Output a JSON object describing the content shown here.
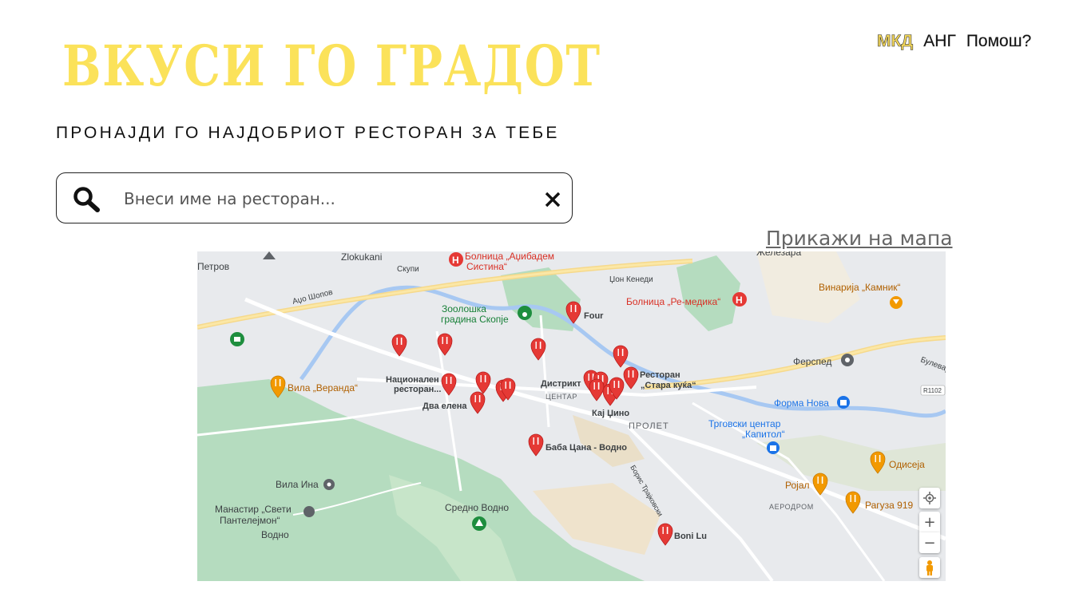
{
  "lang": {
    "mk": "МКД",
    "en": "АНГ",
    "help": "Помош?"
  },
  "header": {
    "title": "ВКУСИ ГО ГРАДОТ",
    "subtitle": "ПРОНАЈДИ ГО НАЈДОБРИОТ РЕСТОРАН ЗА ТЕБЕ"
  },
  "search": {
    "placeholder": "Внеси име на ресторан...",
    "value": ""
  },
  "map_link": "Прикажи на мапа",
  "colors": {
    "accent": "#fbe25a",
    "pin_red": "#e53935",
    "pin_orange": "#f29900",
    "park_green": "#9fd3ad",
    "water": "#a7c8f2"
  },
  "map": {
    "labels": {
      "zlokukani": "Zlokukani",
      "petrov": "Петров",
      "skupi": "Скупи",
      "acoShopov": "Аџо Шопов",
      "hospital_acibadem": "Болница „Аџибадем Систина“",
      "zoo": "Зоолошка градина Скопје",
      "four": "Four",
      "jonKenedi": "Џон Кенеди",
      "hospital_remedika": "Болница „Ре-медика“",
      "vinarija": "Винарија „Камник“",
      "zelezara": "Железара",
      "ferspet": "Ферспед",
      "bulevar": "Булевар",
      "r1102": "R1102",
      "vila_veranda": "Вила „Веранда“",
      "nacionalen1": "Национален",
      "nacionalen2": "ресторан...",
      "dva_elena": "Два елена",
      "distrikt": "Дистрикт",
      "centar": "ЦЕНТАР",
      "kaj_cino": "Кај Џино",
      "restoran1": "Ресторан",
      "restoran2": "„Стара куќа“",
      "prolet": "ПРОЛЕТ",
      "forma_nova": "Форма Нова",
      "trgovski1": "Трговски центар",
      "trgovski2": "„Капитол“",
      "baba_cana": "Баба Цана - Водно",
      "odiseja": "Одисеја",
      "rojal": "Ројал",
      "raguza": "Рагуза 919",
      "aerodrom": "АЕРОДРОМ",
      "vila_ina": "Вила Ина",
      "manastir1": "Манастир „Свети",
      "manastir2": "Пантелејмон“",
      "vodno": "Водно",
      "sredno_vodno": "Средно Водно",
      "boris": "Борис Трајковски",
      "boni_lu": "Boni Lu"
    },
    "controls": {
      "zoom_in": "+",
      "zoom_out": "−"
    }
  }
}
